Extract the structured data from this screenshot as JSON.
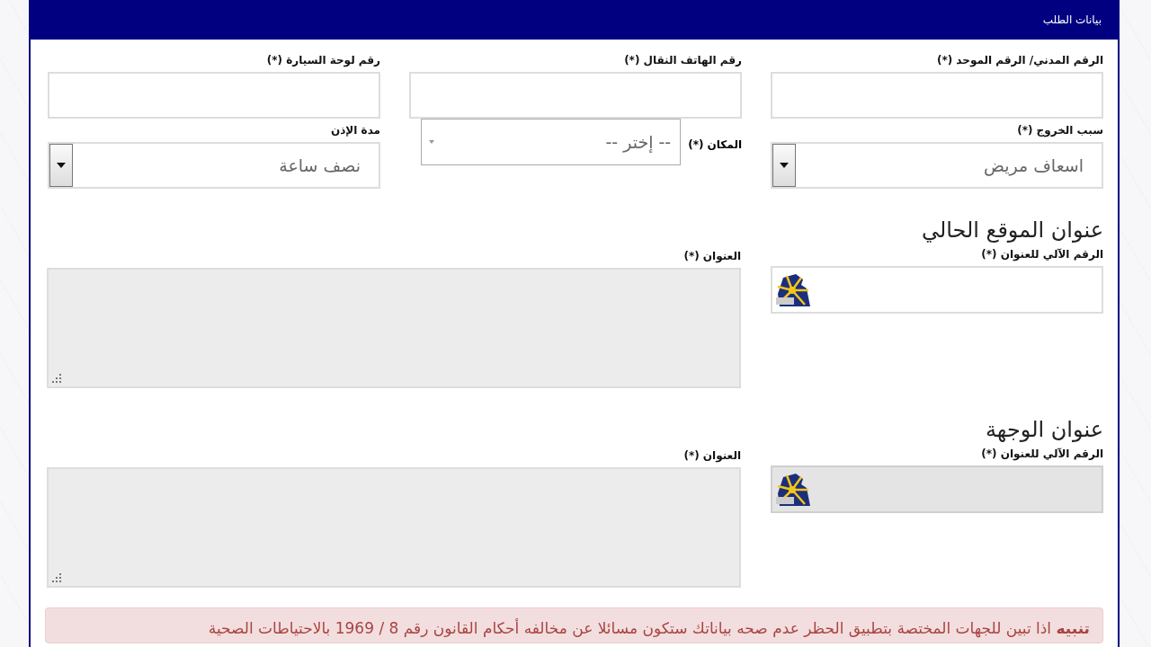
{
  "panel": {
    "title": "بيانات الطلب"
  },
  "fields": [
    {
      "kind": "text",
      "label": "الرقم المدني/ الرقم الموحد (*)"
    },
    {
      "kind": "text",
      "label": "رقم الهاتف النقال (*)"
    },
    {
      "kind": "text",
      "label": "رقم لوحة السيارة (*)"
    },
    {
      "kind": "dropdown",
      "label": "سبب الخروج (*)",
      "value": "اسعاف مريض"
    },
    {
      "kind": "combo",
      "label": "المكان (*)",
      "value": "-- إختر --"
    },
    {
      "kind": "dropdown",
      "label": "مدة الإذن",
      "value": "نصف ساعة"
    }
  ],
  "sections": [
    {
      "heading": "عنوان الموقع الحالي",
      "auto_number": {
        "label": "الرقم الآلي للعنوان (*)",
        "disabled": false
      },
      "address": {
        "label": "العنوان (*)",
        "disabled": true
      }
    },
    {
      "heading": "عنوان الوجهة",
      "auto_number": {
        "label": "الرقم الآلي للعنوان (*)",
        "disabled": true
      },
      "address": {
        "label": "العنوان (*)",
        "disabled": true
      }
    }
  ],
  "notice": {
    "text": "**تنبيه** اذا تبين للجهات المختصة بتطبيق الحظر عدم صحه بياناتك ستكون مسائلا عن مخالفه أحكام القانون رقم 8 / 1969 بالاحتياطات الصحية"
  }
}
